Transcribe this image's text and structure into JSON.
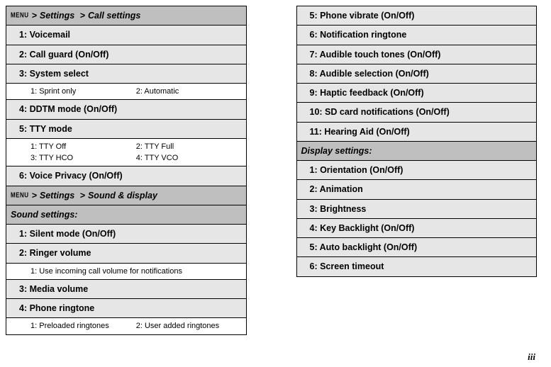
{
  "menuLabel": "MENU",
  "leftColumn": {
    "header1": {
      "pathA": "Settings",
      "pathB": "Call settings"
    },
    "items1": [
      "1: Voicemail",
      "2: Call guard (On/Off)",
      "3: System select"
    ],
    "sub1": [
      "1: Sprint only",
      "2: Automatic"
    ],
    "items2": [
      "4: DDTM mode (On/Off)",
      "5: TTY mode"
    ],
    "sub2": [
      "1: TTY Off",
      "2: TTY Full",
      "3: TTY HCO",
      "4: TTY VCO"
    ],
    "items3": [
      "6: Voice Privacy (On/Off)"
    ],
    "header2": {
      "pathA": "Settings",
      "pathB": "Sound & display"
    },
    "sect1": "Sound settings:",
    "items4": [
      "1: Silent mode (On/Off)",
      "2: Ringer volume"
    ],
    "sub3": [
      "1: Use incoming call volume for notifications"
    ],
    "items5": [
      "3: Media volume",
      "4: Phone ringtone"
    ],
    "sub4": [
      "1: Preloaded ringtones",
      "2: User added ringtones"
    ]
  },
  "rightColumn": {
    "items1": [
      "5: Phone vibrate (On/Off)",
      "6: Notification ringtone",
      "7: Audible touch tones (On/Off)",
      "8: Audible selection (On/Off)",
      "9: Haptic feedback (On/Off)",
      "10: SD card notifications (On/Off)",
      "11: Hearing Aid (On/Off)"
    ],
    "sect1": "Display settings:",
    "items2": [
      "1: Orientation (On/Off)",
      "2: Animation",
      "3: Brightness",
      "4: Key Backlight (On/Off)",
      "5: Auto backlight (On/Off)",
      "6: Screen timeout"
    ]
  },
  "pageNumber": "iii"
}
